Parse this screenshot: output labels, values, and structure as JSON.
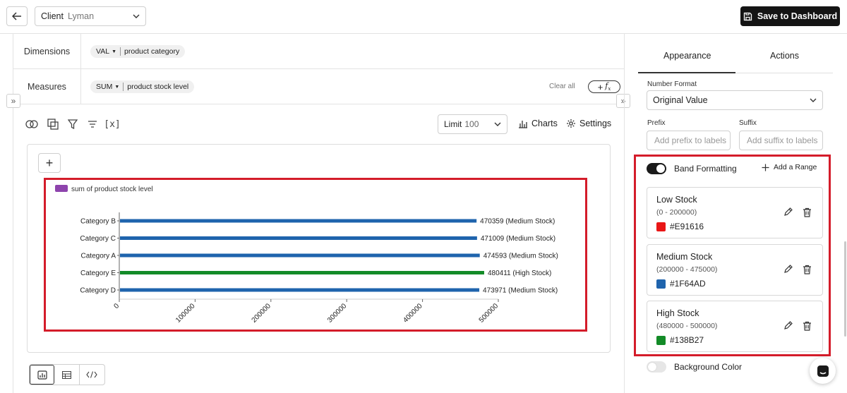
{
  "header": {
    "client_label": "Client",
    "client_value": "Lyman",
    "save_label": "Save to Dashboard"
  },
  "query": {
    "dimensions_label": "Dimensions",
    "dimension_agg": "VAL",
    "dimension_field": "product category",
    "measures_label": "Measures",
    "measure_agg": "SUM",
    "measure_field": "product stock level",
    "clear_all": "Clear all"
  },
  "toolbar": {
    "limit_label": "Limit",
    "limit_value": "100",
    "charts_label": "Charts",
    "settings_label": "Settings",
    "variables_label": "[x]"
  },
  "chart_data": {
    "type": "bar",
    "orientation": "horizontal",
    "legend": "sum of product stock level",
    "categories": [
      "Category B",
      "Category C",
      "Category A",
      "Category E",
      "Category D"
    ],
    "values": [
      470359,
      471009,
      474593,
      480411,
      473971
    ],
    "data_labels": [
      "470359 (Medium Stock)",
      "471009 (Medium Stock)",
      "474593 (Medium Stock)",
      "480411 (High Stock)",
      "473971 (Medium Stock)"
    ],
    "bar_colors": [
      "#1F64AD",
      "#1F64AD",
      "#1F64AD",
      "#138B27",
      "#1F64AD"
    ],
    "xlim": [
      0,
      500000
    ],
    "x_ticks": [
      "0",
      "100000",
      "200000",
      "300000",
      "400000",
      "500000"
    ],
    "legend_color": "#8E44AD"
  },
  "panel": {
    "tab_appearance": "Appearance",
    "tab_actions": "Actions",
    "number_format_label": "Number Format",
    "number_format_value": "Original Value",
    "prefix_label": "Prefix",
    "prefix_placeholder": "Add prefix to labels",
    "suffix_label": "Suffix",
    "suffix_placeholder": "Add suffix to labels",
    "band_formatting_label": "Band Formatting",
    "add_range_label": "Add a Range",
    "background_color_label": "Background Color",
    "bands": [
      {
        "name": "Low Stock",
        "range": "(0 - 200000)",
        "color": "#E91616",
        "hex": "#E91616"
      },
      {
        "name": "Medium Stock",
        "range": "(200000 - 475000)",
        "color": "#1F64AD",
        "hex": "#1F64AD"
      },
      {
        "name": "High Stock",
        "range": "(480000 - 500000)",
        "color": "#138B27",
        "hex": "#138B27"
      }
    ]
  }
}
